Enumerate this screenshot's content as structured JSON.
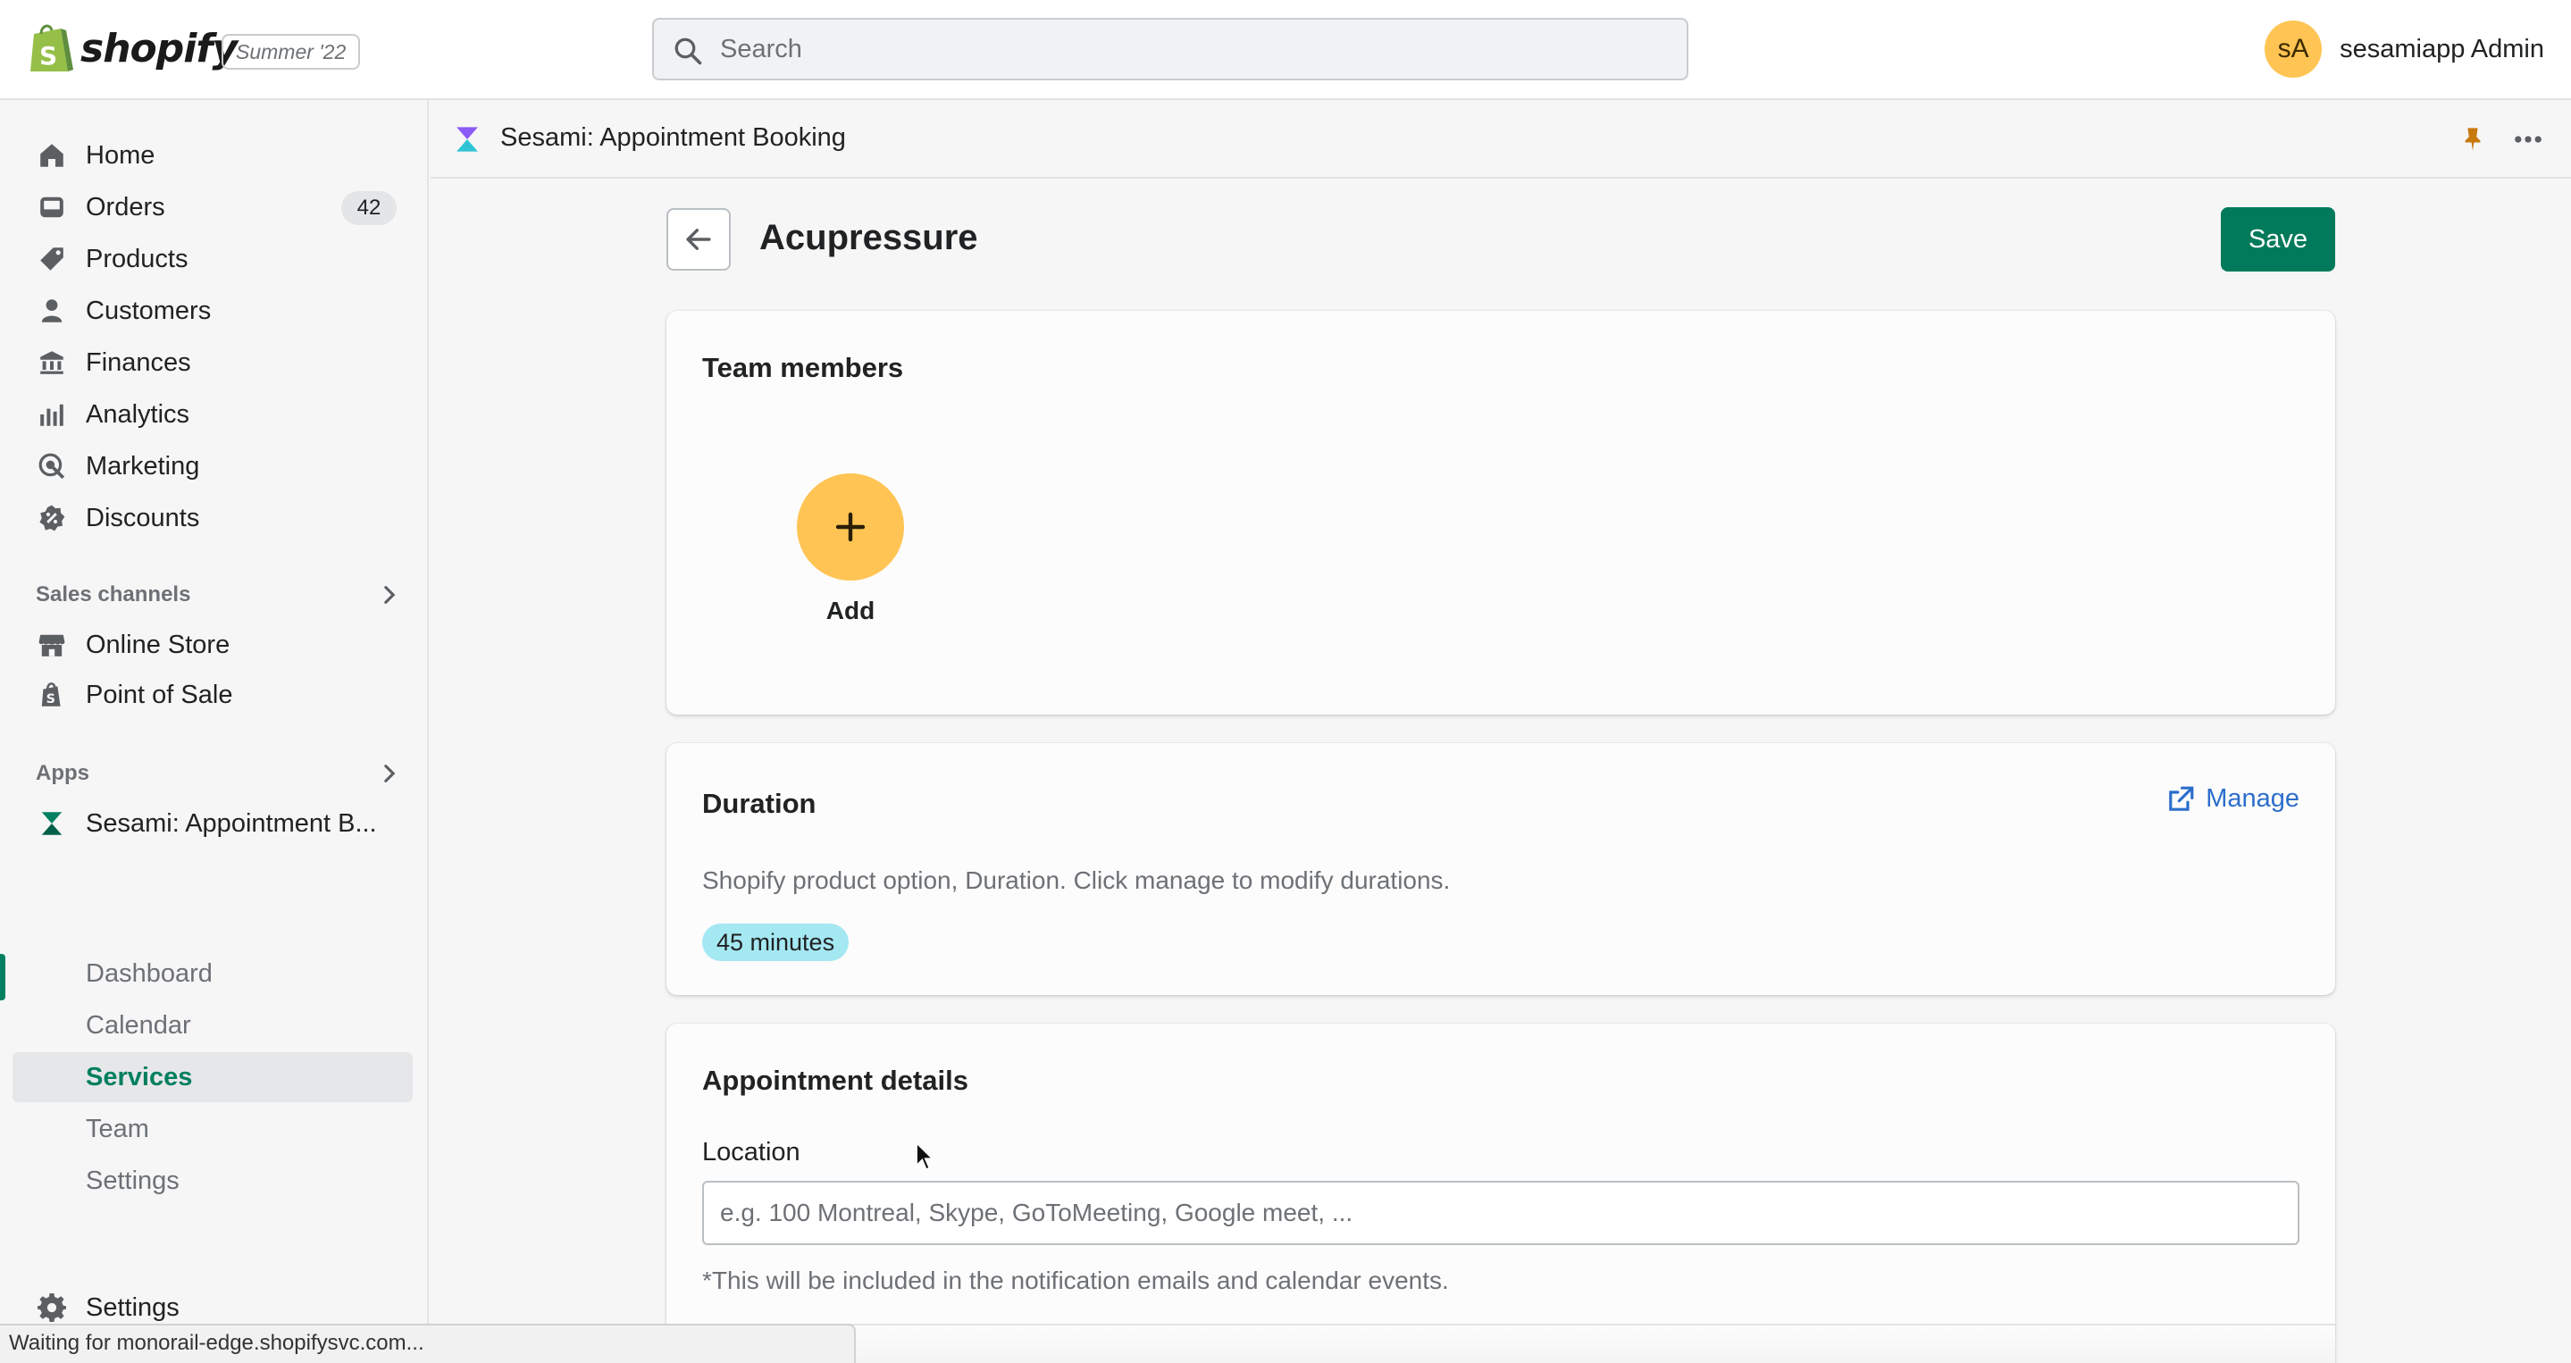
{
  "topbar": {
    "logo_text": "shopify",
    "edition": "Summer '22",
    "search_placeholder": "Search",
    "user_initials": "sA",
    "user_name": "sesamiapp Admin"
  },
  "sidebar": {
    "items": [
      {
        "label": "Home",
        "icon": "home-icon"
      },
      {
        "label": "Orders",
        "icon": "orders-icon",
        "badge": "42"
      },
      {
        "label": "Products",
        "icon": "tag-icon"
      },
      {
        "label": "Customers",
        "icon": "person-icon"
      },
      {
        "label": "Finances",
        "icon": "bank-icon"
      },
      {
        "label": "Analytics",
        "icon": "bar-chart-icon"
      },
      {
        "label": "Marketing",
        "icon": "target-icon"
      },
      {
        "label": "Discounts",
        "icon": "discount-icon"
      }
    ],
    "sales_channels_label": "Sales channels",
    "channels": [
      {
        "label": "Online Store",
        "icon": "store-icon"
      },
      {
        "label": "Point of Sale",
        "icon": "pos-bag-icon"
      }
    ],
    "apps_label": "Apps",
    "app_name": "Sesami: Appointment B...",
    "app_sub_items": [
      "Dashboard",
      "Calendar",
      "Services",
      "Team",
      "Settings"
    ],
    "active_sub_item": "Services",
    "settings_label": "Settings"
  },
  "app_header": {
    "title": "Sesami: Appointment Booking"
  },
  "page": {
    "title": "Acupressure",
    "save_label": "Save"
  },
  "team_card": {
    "title": "Team members",
    "add_label": "Add"
  },
  "duration_card": {
    "title": "Duration",
    "manage_label": "Manage",
    "description": "Shopify product option, Duration. Click manage to modify durations.",
    "tag": "45 minutes"
  },
  "appointment_card": {
    "title": "Appointment details",
    "location_label": "Location",
    "location_placeholder": "e.g. 100 Montreal, Skype, GoToMeeting, Google meet, ...",
    "location_value": "",
    "help_text": "*This will be included in the notification emails and calendar events."
  },
  "status_bar": {
    "text": "Waiting for monorail-edge.shopifysvc.com..."
  },
  "colors": {
    "primary_green": "#007a5a",
    "avatar_yellow": "#ffc453",
    "link_blue": "#2c6ecb",
    "tag_cyan": "#a4e8f2"
  }
}
